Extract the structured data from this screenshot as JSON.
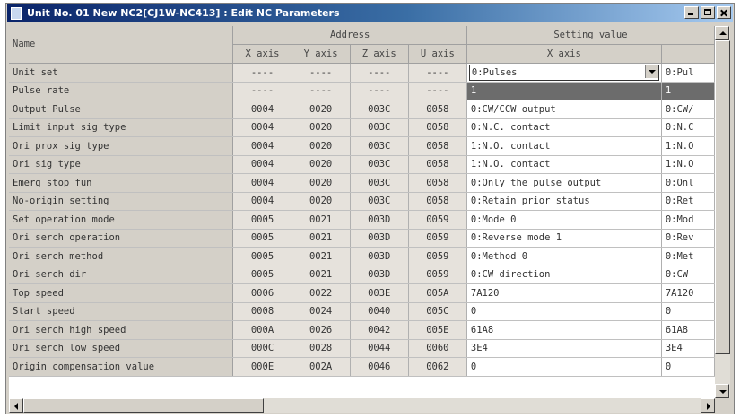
{
  "window": {
    "title": "Unit No. 01 New NC2[CJ1W-NC413] : Edit NC Parameters"
  },
  "columns": {
    "name": "Name",
    "address_group": "Address",
    "setting_group": "Setting value",
    "address_axes": [
      "X axis",
      "Y axis",
      "Z axis",
      "U axis"
    ],
    "setting_axes": [
      "X axis",
      ""
    ]
  },
  "rows": [
    {
      "name": "Unit set",
      "addr": [
        "----",
        "----",
        "----",
        "----"
      ],
      "x": "0:Pulses",
      "y": "0:Pul"
    },
    {
      "name": "Pulse rate",
      "addr": [
        "----",
        "----",
        "----",
        "----"
      ],
      "x": "1",
      "y": "1"
    },
    {
      "name": "Output Pulse",
      "addr": [
        "0004",
        "0020",
        "003C",
        "0058"
      ],
      "x": "0:CW/CCW output",
      "y": "0:CW/"
    },
    {
      "name": "Limit input sig type",
      "addr": [
        "0004",
        "0020",
        "003C",
        "0058"
      ],
      "x": "0:N.C. contact",
      "y": "0:N.C"
    },
    {
      "name": "Ori prox sig type",
      "addr": [
        "0004",
        "0020",
        "003C",
        "0058"
      ],
      "x": "1:N.O. contact",
      "y": "1:N.O"
    },
    {
      "name": "Ori sig type",
      "addr": [
        "0004",
        "0020",
        "003C",
        "0058"
      ],
      "x": "1:N.O. contact",
      "y": "1:N.O"
    },
    {
      "name": "Emerg stop fun",
      "addr": [
        "0004",
        "0020",
        "003C",
        "0058"
      ],
      "x": "0:Only the pulse output",
      "y": "0:Onl"
    },
    {
      "name": "No-origin setting",
      "addr": [
        "0004",
        "0020",
        "003C",
        "0058"
      ],
      "x": "0:Retain prior status",
      "y": "0:Ret"
    },
    {
      "name": "Set operation mode",
      "addr": [
        "0005",
        "0021",
        "003D",
        "0059"
      ],
      "x": "0:Mode 0",
      "y": "0:Mod"
    },
    {
      "name": "Ori serch operation",
      "addr": [
        "0005",
        "0021",
        "003D",
        "0059"
      ],
      "x": "0:Reverse mode 1",
      "y": "0:Rev"
    },
    {
      "name": "Ori serch method",
      "addr": [
        "0005",
        "0021",
        "003D",
        "0059"
      ],
      "x": "0:Method 0",
      "y": "0:Met"
    },
    {
      "name": "Ori serch dir",
      "addr": [
        "0005",
        "0021",
        "003D",
        "0059"
      ],
      "x": "0:CW direction",
      "y": "0:CW"
    },
    {
      "name": "Top speed",
      "addr": [
        "0006",
        "0022",
        "003E",
        "005A"
      ],
      "x": "7A120",
      "y": "7A120"
    },
    {
      "name": "Start speed",
      "addr": [
        "0008",
        "0024",
        "0040",
        "005C"
      ],
      "x": "0",
      "y": "0"
    },
    {
      "name": "Ori serch high speed",
      "addr": [
        "000A",
        "0026",
        "0042",
        "005E"
      ],
      "x": "61A8",
      "y": "61A8"
    },
    {
      "name": "Ori serch low speed",
      "addr": [
        "000C",
        "0028",
        "0044",
        "0060"
      ],
      "x": "3E4",
      "y": "3E4"
    },
    {
      "name": "Origin compensation value",
      "addr": [
        "000E",
        "002A",
        "0046",
        "0062"
      ],
      "x": "0",
      "y": "0"
    }
  ],
  "selected_row": 1
}
